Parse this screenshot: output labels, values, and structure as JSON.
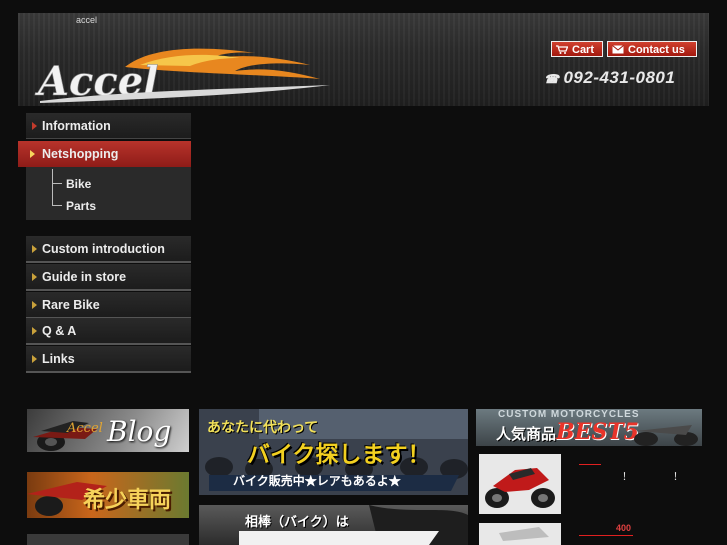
{
  "header": {
    "site_name": "accel",
    "logo_text": "Accel",
    "cart_label": "Cart",
    "contact_label": "Contact us",
    "phone": "092-431-0801"
  },
  "nav": {
    "information": "Information",
    "netshopping": "Netshopping",
    "sub": [
      "Bike",
      "Parts"
    ],
    "secondary": [
      "Custom introduction",
      "Guide in store",
      "Rare Bike",
      "Q & A",
      "Links"
    ]
  },
  "banners": {
    "blog": "Blog",
    "blog_prefix": "Accel",
    "rare": "希少車両",
    "search_top": "あなたに代わって",
    "search_main": "バイク探します！",
    "search_sub": "バイク販売中★レアもあるよ★",
    "sell_top": "相棒（バイク）は",
    "best5_top": "CUSTOM MOTORCYCLES",
    "best5_main": "人気商品",
    "best5_em": "BEST5"
  },
  "products": {
    "p1_excl_a": "！",
    "p1_excl_b": "！",
    "p2_price": "400"
  },
  "colors": {
    "accent_red": "#b8332b",
    "arrow_gold": "#c9a13b",
    "background": "#0d0d0d"
  }
}
